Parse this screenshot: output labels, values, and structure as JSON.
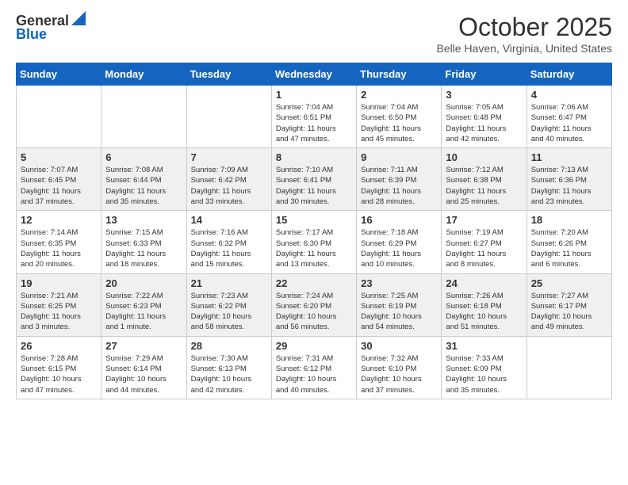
{
  "header": {
    "logo": {
      "line1": "General",
      "line2": "Blue"
    },
    "title": "October 2025",
    "subtitle": "Belle Haven, Virginia, United States"
  },
  "days_of_week": [
    "Sunday",
    "Monday",
    "Tuesday",
    "Wednesday",
    "Thursday",
    "Friday",
    "Saturday"
  ],
  "weeks": [
    [
      {
        "day": "",
        "info": ""
      },
      {
        "day": "",
        "info": ""
      },
      {
        "day": "",
        "info": ""
      },
      {
        "day": "1",
        "info": "Sunrise: 7:04 AM\nSunset: 6:51 PM\nDaylight: 11 hours\nand 47 minutes."
      },
      {
        "day": "2",
        "info": "Sunrise: 7:04 AM\nSunset: 6:50 PM\nDaylight: 11 hours\nand 45 minutes."
      },
      {
        "day": "3",
        "info": "Sunrise: 7:05 AM\nSunset: 6:48 PM\nDaylight: 11 hours\nand 42 minutes."
      },
      {
        "day": "4",
        "info": "Sunrise: 7:06 AM\nSunset: 6:47 PM\nDaylight: 11 hours\nand 40 minutes."
      }
    ],
    [
      {
        "day": "5",
        "info": "Sunrise: 7:07 AM\nSunset: 6:45 PM\nDaylight: 11 hours\nand 37 minutes."
      },
      {
        "day": "6",
        "info": "Sunrise: 7:08 AM\nSunset: 6:44 PM\nDaylight: 11 hours\nand 35 minutes."
      },
      {
        "day": "7",
        "info": "Sunrise: 7:09 AM\nSunset: 6:42 PM\nDaylight: 11 hours\nand 33 minutes."
      },
      {
        "day": "8",
        "info": "Sunrise: 7:10 AM\nSunset: 6:41 PM\nDaylight: 11 hours\nand 30 minutes."
      },
      {
        "day": "9",
        "info": "Sunrise: 7:11 AM\nSunset: 6:39 PM\nDaylight: 11 hours\nand 28 minutes."
      },
      {
        "day": "10",
        "info": "Sunrise: 7:12 AM\nSunset: 6:38 PM\nDaylight: 11 hours\nand 25 minutes."
      },
      {
        "day": "11",
        "info": "Sunrise: 7:13 AM\nSunset: 6:36 PM\nDaylight: 11 hours\nand 23 minutes."
      }
    ],
    [
      {
        "day": "12",
        "info": "Sunrise: 7:14 AM\nSunset: 6:35 PM\nDaylight: 11 hours\nand 20 minutes."
      },
      {
        "day": "13",
        "info": "Sunrise: 7:15 AM\nSunset: 6:33 PM\nDaylight: 11 hours\nand 18 minutes."
      },
      {
        "day": "14",
        "info": "Sunrise: 7:16 AM\nSunset: 6:32 PM\nDaylight: 11 hours\nand 15 minutes."
      },
      {
        "day": "15",
        "info": "Sunrise: 7:17 AM\nSunset: 6:30 PM\nDaylight: 11 hours\nand 13 minutes."
      },
      {
        "day": "16",
        "info": "Sunrise: 7:18 AM\nSunset: 6:29 PM\nDaylight: 11 hours\nand 10 minutes."
      },
      {
        "day": "17",
        "info": "Sunrise: 7:19 AM\nSunset: 6:27 PM\nDaylight: 11 hours\nand 8 minutes."
      },
      {
        "day": "18",
        "info": "Sunrise: 7:20 AM\nSunset: 6:26 PM\nDaylight: 11 hours\nand 6 minutes."
      }
    ],
    [
      {
        "day": "19",
        "info": "Sunrise: 7:21 AM\nSunset: 6:25 PM\nDaylight: 11 hours\nand 3 minutes."
      },
      {
        "day": "20",
        "info": "Sunrise: 7:22 AM\nSunset: 6:23 PM\nDaylight: 11 hours\nand 1 minute."
      },
      {
        "day": "21",
        "info": "Sunrise: 7:23 AM\nSunset: 6:22 PM\nDaylight: 10 hours\nand 58 minutes."
      },
      {
        "day": "22",
        "info": "Sunrise: 7:24 AM\nSunset: 6:20 PM\nDaylight: 10 hours\nand 56 minutes."
      },
      {
        "day": "23",
        "info": "Sunrise: 7:25 AM\nSunset: 6:19 PM\nDaylight: 10 hours\nand 54 minutes."
      },
      {
        "day": "24",
        "info": "Sunrise: 7:26 AM\nSunset: 6:18 PM\nDaylight: 10 hours\nand 51 minutes."
      },
      {
        "day": "25",
        "info": "Sunrise: 7:27 AM\nSunset: 6:17 PM\nDaylight: 10 hours\nand 49 minutes."
      }
    ],
    [
      {
        "day": "26",
        "info": "Sunrise: 7:28 AM\nSunset: 6:15 PM\nDaylight: 10 hours\nand 47 minutes."
      },
      {
        "day": "27",
        "info": "Sunrise: 7:29 AM\nSunset: 6:14 PM\nDaylight: 10 hours\nand 44 minutes."
      },
      {
        "day": "28",
        "info": "Sunrise: 7:30 AM\nSunset: 6:13 PM\nDaylight: 10 hours\nand 42 minutes."
      },
      {
        "day": "29",
        "info": "Sunrise: 7:31 AM\nSunset: 6:12 PM\nDaylight: 10 hours\nand 40 minutes."
      },
      {
        "day": "30",
        "info": "Sunrise: 7:32 AM\nSunset: 6:10 PM\nDaylight: 10 hours\nand 37 minutes."
      },
      {
        "day": "31",
        "info": "Sunrise: 7:33 AM\nSunset: 6:09 PM\nDaylight: 10 hours\nand 35 minutes."
      },
      {
        "day": "",
        "info": ""
      }
    ]
  ]
}
